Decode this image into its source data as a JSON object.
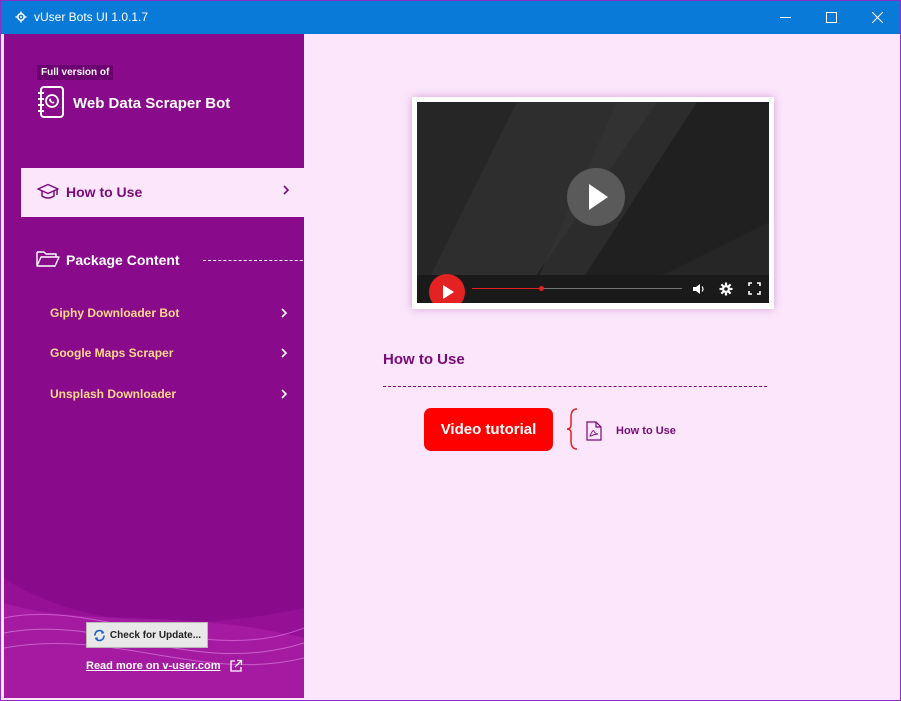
{
  "window": {
    "title": "vUser Bots UI 1.0.1.7"
  },
  "brand": {
    "subtitle": "Full version of",
    "title": "Web Data Scraper Bot"
  },
  "nav": {
    "how_to_use": "How to Use",
    "package_content": "Package Content",
    "items": [
      {
        "label": "Giphy Downloader Bot"
      },
      {
        "label": "Google Maps Scraper"
      },
      {
        "label": "Unsplash Downloader"
      }
    ]
  },
  "footer": {
    "update_label": "Check for Update...",
    "read_more": "Read more on v-user.com"
  },
  "main": {
    "section_title": "How to Use",
    "video_tutorial_label": "Video tutorial",
    "pdf_label": "How to Use",
    "video_progress": 0.33
  },
  "colors": {
    "accent": "#8a0a8c",
    "titlebar": "#0a7ad8",
    "content_bg": "#fbe6fb",
    "cta": "#ff0000",
    "nav_sub_text": "#ffd98a"
  },
  "icons": {
    "app": "gear-icon",
    "brand": "notebook-phone-icon",
    "how_to_use": "graduation-cap-icon",
    "package": "folder-open-icon",
    "update": "refresh-icon",
    "read_more": "external-link-icon",
    "pdf": "pdf-icon"
  }
}
